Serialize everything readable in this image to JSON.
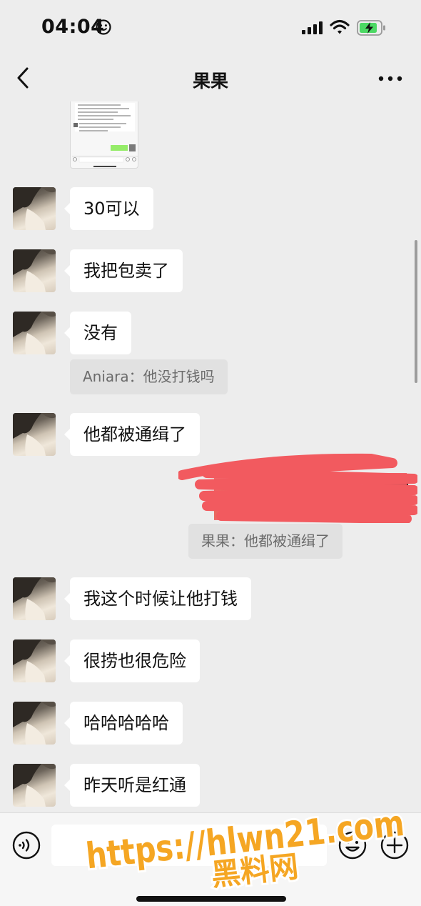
{
  "status_bar": {
    "time": "04:04",
    "icons": [
      "smiley-face-icon",
      "cellular-signal-icon",
      "wifi-icon",
      "battery-charging-icon"
    ],
    "battery_color": "#4cd964"
  },
  "nav": {
    "title": "果果",
    "back_icon": "chevron-left-icon",
    "more_icon": "ellipsis-icon"
  },
  "messages": [
    {
      "type": "incoming",
      "text": "30可以"
    },
    {
      "type": "incoming",
      "text": "我把包卖了"
    },
    {
      "type": "incoming",
      "text": "没有"
    },
    {
      "type": "quote",
      "text": "Aniara：他没打钱吗"
    },
    {
      "type": "incoming",
      "text": "他都被通缉了"
    },
    {
      "type": "outgoing-redacted",
      "text": ""
    },
    {
      "type": "quote",
      "text": "果果：他都被通缉了"
    },
    {
      "type": "incoming",
      "text": "我这个时候让他打钱"
    },
    {
      "type": "incoming",
      "text": "很捞也很危险"
    },
    {
      "type": "incoming",
      "text": "哈哈哈哈哈"
    },
    {
      "type": "incoming",
      "text": "昨天听是红通"
    }
  ],
  "input_bar": {
    "voice_icon": "voice-icon",
    "emoji_icon": "emoji-icon",
    "plus_icon": "plus-icon",
    "input_value": ""
  },
  "watermark": {
    "line1": "https://hlwn21.com",
    "line2": "黑料网",
    "color": "#f5a623"
  },
  "colors": {
    "background": "#ededed",
    "bubble": "#ffffff",
    "quote_background": "#e1e1e1",
    "redaction": "#f25a5f"
  }
}
